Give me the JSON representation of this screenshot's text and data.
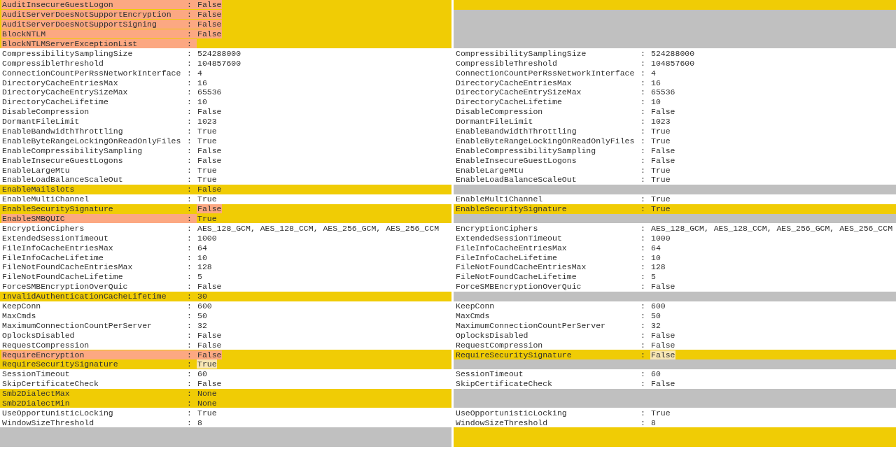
{
  "rows": [
    {
      "left": {
        "kind": "changed",
        "key": "AuditInsecureGuestLogon",
        "sep": ":",
        "value": "False",
        "key_marked": true,
        "value_marked": true
      },
      "right": {
        "kind": "changed"
      }
    },
    {
      "left": {
        "kind": "changed",
        "key": "AuditServerDoesNotSupportEncryption",
        "sep": ":",
        "value": "False",
        "key_marked": true,
        "value_marked": true
      },
      "right": {
        "kind": "empty"
      }
    },
    {
      "left": {
        "kind": "changed",
        "key": "AuditServerDoesNotSupportSigning",
        "sep": ":",
        "value": "False",
        "key_marked": true,
        "value_marked": true
      },
      "right": {
        "kind": "empty"
      }
    },
    {
      "left": {
        "kind": "changed",
        "key": "BlockNTLM",
        "sep": ":",
        "value": "False",
        "key_marked": true,
        "value_marked": true
      },
      "right": {
        "kind": "empty"
      }
    },
    {
      "left": {
        "kind": "changed",
        "key": "BlockNTLMServerExceptionList",
        "sep": ":",
        "key_marked": true
      },
      "right": {
        "kind": "empty"
      }
    },
    {
      "left": {
        "kind": "same",
        "key": "CompressibilitySamplingSize",
        "sep": ":",
        "value": "524288000"
      },
      "right": {
        "kind": "same",
        "key": "CompressibilitySamplingSize",
        "sep": ":",
        "value": "524288000"
      }
    },
    {
      "left": {
        "kind": "same",
        "key": "CompressibleThreshold",
        "sep": ":",
        "value": "104857600"
      },
      "right": {
        "kind": "same",
        "key": "CompressibleThreshold",
        "sep": ":",
        "value": "104857600"
      }
    },
    {
      "left": {
        "kind": "same",
        "key": "ConnectionCountPerRssNetworkInterface",
        "sep": ":",
        "value": "4"
      },
      "right": {
        "kind": "same",
        "key": "ConnectionCountPerRssNetworkInterface",
        "sep": ":",
        "value": "4"
      }
    },
    {
      "left": {
        "kind": "same",
        "key": "DirectoryCacheEntriesMax",
        "sep": ":",
        "value": "16"
      },
      "right": {
        "kind": "same",
        "key": "DirectoryCacheEntriesMax",
        "sep": ":",
        "value": "16"
      }
    },
    {
      "left": {
        "kind": "same",
        "key": "DirectoryCacheEntrySizeMax",
        "sep": ":",
        "value": "65536"
      },
      "right": {
        "kind": "same",
        "key": "DirectoryCacheEntrySizeMax",
        "sep": ":",
        "value": "65536"
      }
    },
    {
      "left": {
        "kind": "same",
        "key": "DirectoryCacheLifetime",
        "sep": ":",
        "value": "10"
      },
      "right": {
        "kind": "same",
        "key": "DirectoryCacheLifetime",
        "sep": ":",
        "value": "10"
      }
    },
    {
      "left": {
        "kind": "same",
        "key": "DisableCompression",
        "sep": ":",
        "value": "False"
      },
      "right": {
        "kind": "same",
        "key": "DisableCompression",
        "sep": ":",
        "value": "False"
      }
    },
    {
      "left": {
        "kind": "same",
        "key": "DormantFileLimit",
        "sep": ":",
        "value": "1023"
      },
      "right": {
        "kind": "same",
        "key": "DormantFileLimit",
        "sep": ":",
        "value": "1023"
      }
    },
    {
      "left": {
        "kind": "same",
        "key": "EnableBandwidthThrottling",
        "sep": ":",
        "value": "True"
      },
      "right": {
        "kind": "same",
        "key": "EnableBandwidthThrottling",
        "sep": ":",
        "value": "True"
      }
    },
    {
      "left": {
        "kind": "same",
        "key": "EnableByteRangeLockingOnReadOnlyFiles",
        "sep": ":",
        "value": "True"
      },
      "right": {
        "kind": "same",
        "key": "EnableByteRangeLockingOnReadOnlyFiles",
        "sep": ":",
        "value": "True"
      }
    },
    {
      "left": {
        "kind": "same",
        "key": "EnableCompressibilitySampling",
        "sep": ":",
        "value": "False"
      },
      "right": {
        "kind": "same",
        "key": "EnableCompressibilitySampling",
        "sep": ":",
        "value": "False"
      }
    },
    {
      "left": {
        "kind": "same",
        "key": "EnableInsecureGuestLogons",
        "sep": ":",
        "value": "False"
      },
      "right": {
        "kind": "same",
        "key": "EnableInsecureGuestLogons",
        "sep": ":",
        "value": "False"
      }
    },
    {
      "left": {
        "kind": "same",
        "key": "EnableLargeMtu",
        "sep": ":",
        "value": "True"
      },
      "right": {
        "kind": "same",
        "key": "EnableLargeMtu",
        "sep": ":",
        "value": "True"
      }
    },
    {
      "left": {
        "kind": "same",
        "key": "EnableLoadBalanceScaleOut",
        "sep": ":",
        "value": "True"
      },
      "right": {
        "kind": "same",
        "key": "EnableLoadBalanceScaleOut",
        "sep": ":",
        "value": "True"
      }
    },
    {
      "left": {
        "kind": "changed",
        "key": "EnableMailslots",
        "sep": ":",
        "value": "False"
      },
      "right": {
        "kind": "empty"
      }
    },
    {
      "left": {
        "kind": "same",
        "key": "EnableMultiChannel",
        "sep": ":",
        "value": "True"
      },
      "right": {
        "kind": "same",
        "key": "EnableMultiChannel",
        "sep": ":",
        "value": "True"
      }
    },
    {
      "left": {
        "kind": "changed",
        "key": "EnableSecuritySignature",
        "sep": ":",
        "value": "False",
        "value_marked": true
      },
      "right": {
        "kind": "changed",
        "key": "EnableSecuritySignature",
        "sep": ":",
        "value": "True"
      }
    },
    {
      "left": {
        "kind": "changed",
        "key": "EnableSMBQUIC",
        "sep": ":",
        "value": "True",
        "key_marked": true
      },
      "right": {
        "kind": "empty"
      }
    },
    {
      "left": {
        "kind": "same",
        "key": "EncryptionCiphers",
        "sep": ":",
        "value": "AES_128_GCM, AES_128_CCM, AES_256_GCM, AES_256_CCM"
      },
      "right": {
        "kind": "same",
        "key": "EncryptionCiphers",
        "sep": ":",
        "value": "AES_128_GCM, AES_128_CCM, AES_256_GCM, AES_256_CCM"
      }
    },
    {
      "left": {
        "kind": "same",
        "key": "ExtendedSessionTimeout",
        "sep": ":",
        "value": "1000"
      },
      "right": {
        "kind": "same",
        "key": "ExtendedSessionTimeout",
        "sep": ":",
        "value": "1000"
      }
    },
    {
      "left": {
        "kind": "same",
        "key": "FileInfoCacheEntriesMax",
        "sep": ":",
        "value": "64"
      },
      "right": {
        "kind": "same",
        "key": "FileInfoCacheEntriesMax",
        "sep": ":",
        "value": "64"
      }
    },
    {
      "left": {
        "kind": "same",
        "key": "FileInfoCacheLifetime",
        "sep": ":",
        "value": "10"
      },
      "right": {
        "kind": "same",
        "key": "FileInfoCacheLifetime",
        "sep": ":",
        "value": "10"
      }
    },
    {
      "left": {
        "kind": "same",
        "key": "FileNotFoundCacheEntriesMax",
        "sep": ":",
        "value": "128"
      },
      "right": {
        "kind": "same",
        "key": "FileNotFoundCacheEntriesMax",
        "sep": ":",
        "value": "128"
      }
    },
    {
      "left": {
        "kind": "same",
        "key": "FileNotFoundCacheLifetime",
        "sep": ":",
        "value": "5"
      },
      "right": {
        "kind": "same",
        "key": "FileNotFoundCacheLifetime",
        "sep": ":",
        "value": "5"
      }
    },
    {
      "left": {
        "kind": "same",
        "key": "ForceSMBEncryptionOverQuic",
        "sep": ":",
        "value": "False"
      },
      "right": {
        "kind": "same",
        "key": "ForceSMBEncryptionOverQuic",
        "sep": ":",
        "value": "False"
      }
    },
    {
      "left": {
        "kind": "changed",
        "key": "InvalidAuthenticationCacheLifetime",
        "sep": ":",
        "value": "30"
      },
      "right": {
        "kind": "empty"
      }
    },
    {
      "left": {
        "kind": "same",
        "key": "KeepConn",
        "sep": ":",
        "value": "600"
      },
      "right": {
        "kind": "same",
        "key": "KeepConn",
        "sep": ":",
        "value": "600"
      }
    },
    {
      "left": {
        "kind": "same",
        "key": "MaxCmds",
        "sep": ":",
        "value": "50"
      },
      "right": {
        "kind": "same",
        "key": "MaxCmds",
        "sep": ":",
        "value": "50"
      }
    },
    {
      "left": {
        "kind": "same",
        "key": "MaximumConnectionCountPerServer",
        "sep": ":",
        "value": "32"
      },
      "right": {
        "kind": "same",
        "key": "MaximumConnectionCountPerServer",
        "sep": ":",
        "value": "32"
      }
    },
    {
      "left": {
        "kind": "same",
        "key": "OplocksDisabled",
        "sep": ":",
        "value": "False"
      },
      "right": {
        "kind": "same",
        "key": "OplocksDisabled",
        "sep": ":",
        "value": "False"
      }
    },
    {
      "left": {
        "kind": "same",
        "key": "RequestCompression",
        "sep": ":",
        "value": "False"
      },
      "right": {
        "kind": "same",
        "key": "RequestCompression",
        "sep": ":",
        "value": "False"
      }
    },
    {
      "left": {
        "kind": "changed",
        "key": "RequireEncryption",
        "sep": ":",
        "value": "False",
        "key_marked": true,
        "value_marked": true
      },
      "right": {
        "kind": "changed",
        "key": "RequireSecuritySignature",
        "sep": ":",
        "value": "False",
        "value_soft_marked": true
      }
    },
    {
      "left": {
        "kind": "changed",
        "key": "RequireSecuritySignature",
        "sep": ":",
        "value": "True",
        "value_soft_marked": true
      },
      "right": {
        "kind": "empty"
      }
    },
    {
      "left": {
        "kind": "same",
        "key": "SessionTimeout",
        "sep": ":",
        "value": "60"
      },
      "right": {
        "kind": "same",
        "key": "SessionTimeout",
        "sep": ":",
        "value": "60"
      }
    },
    {
      "left": {
        "kind": "same",
        "key": "SkipCertificateCheck",
        "sep": ":",
        "value": "False"
      },
      "right": {
        "kind": "same",
        "key": "SkipCertificateCheck",
        "sep": ":",
        "value": "False"
      }
    },
    {
      "left": {
        "kind": "changed",
        "key": "Smb2DialectMax",
        "sep": ":",
        "value": "None"
      },
      "right": {
        "kind": "empty"
      }
    },
    {
      "left": {
        "kind": "changed",
        "key": "Smb2DialectMin",
        "sep": ":",
        "value": "None"
      },
      "right": {
        "kind": "empty"
      }
    },
    {
      "left": {
        "kind": "same",
        "key": "UseOpportunisticLocking",
        "sep": ":",
        "value": "True"
      },
      "right": {
        "kind": "same",
        "key": "UseOpportunisticLocking",
        "sep": ":",
        "value": "True"
      }
    },
    {
      "left": {
        "kind": "same",
        "key": "WindowSizeThreshold",
        "sep": ":",
        "value": "8"
      },
      "right": {
        "kind": "same",
        "key": "WindowSizeThreshold",
        "sep": ":",
        "value": "8"
      }
    },
    {
      "left": {
        "kind": "empty"
      },
      "right": {
        "kind": "changed"
      }
    },
    {
      "left": {
        "kind": "empty"
      },
      "right": {
        "kind": "changed"
      }
    }
  ]
}
